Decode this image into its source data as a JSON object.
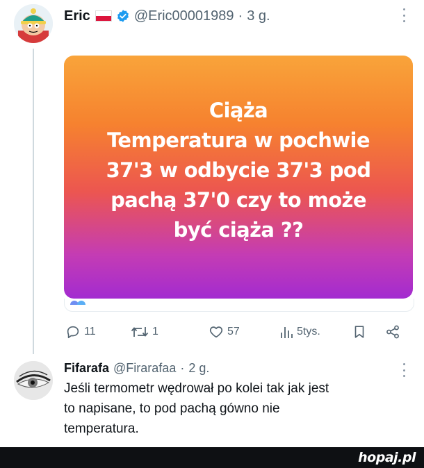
{
  "tweet": {
    "author_name": "Eric",
    "flag_icon": "poland-flag-icon",
    "verified_icon": "verified-badge-icon",
    "handle": "@Eric00001989",
    "separator": "·",
    "time": "3 g.",
    "image_text_lines": [
      "Ciąża",
      "Temperatura w pochwie",
      "37'3 w odbycie 37'3 pod",
      "pachą 37'0 czy to może",
      "być ciąża ??"
    ],
    "gradient_colors": [
      "#f9a43a",
      "#ec5650",
      "#a32bd0"
    ],
    "actions": {
      "replies": "11",
      "retweets": "1",
      "likes": "57",
      "views": "5tys."
    }
  },
  "reply": {
    "author_name": "Fifarafa",
    "handle": "@Firarafaa",
    "separator": "·",
    "time": "2 g.",
    "text_lines": [
      "Jeśli termometr wędrował po kolei tak jak jest",
      "to napisane, to pod pachą gówno nie",
      "temperatura."
    ]
  },
  "footer": {
    "brand": "hopaj.pl"
  },
  "colors": {
    "accent": "#1d9bf0",
    "muted": "#536471",
    "footer_bg": "#0e1013"
  }
}
